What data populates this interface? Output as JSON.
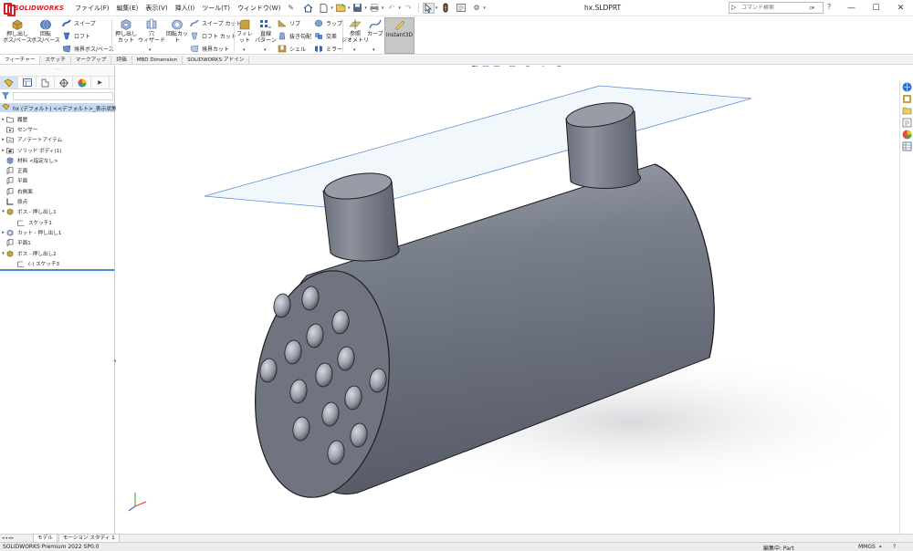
{
  "app": {
    "logo_text": "SOLIDWORKS",
    "menu": [
      "ファイル(F)",
      "編集(E)",
      "表示(V)",
      "挿入(I)",
      "ツール(T)",
      "ウィンドウ(W)"
    ],
    "document_title": "hx.SLDPRT",
    "search_placeholder": "コマンド検索",
    "help_label": "?",
    "window_buttons": [
      "—",
      "☐",
      "✕"
    ]
  },
  "ribbon": {
    "extrude_boss": "押し出し\nボス/ベース",
    "revolve_boss": "回転\nボス/ベース",
    "sweep": "スイープ",
    "loft": "ロフト",
    "boundary_boss": "境界ボス/ベース",
    "extrude_cut": "押し出し\nカット",
    "hole_wizard": "穴\nウィザード",
    "revolve_cut": "回転カット",
    "swept_cut": "スイープ カット",
    "lofted_cut": "ロフト カット",
    "boundary_cut": "境界カット",
    "fillet": "フィレット",
    "linear_pattern": "直線\nパターン",
    "rib": "リブ",
    "draft": "抜き勾配",
    "shell": "シェル",
    "wrap": "ラップ",
    "intersect": "交差",
    "mirror": "ミラー",
    "ref_geometry": "参照\nジオメトリ",
    "curves": "カーブ",
    "instant3d": "Instant3D"
  },
  "cm_tabs": [
    "フィーチャー",
    "スケッチ",
    "マークアップ",
    "評価",
    "MBD Dimension",
    "SOLIDWORKS アドイン"
  ],
  "tree": {
    "root": "hx (デフォルト) <<デフォルト>_表示状態 1>",
    "items": [
      {
        "label": "履歴",
        "expand": "▸"
      },
      {
        "label": "センサー",
        "expand": ""
      },
      {
        "label": "アノテートアイテム",
        "expand": "▸"
      },
      {
        "label": "ソリッド ボディ(1)",
        "expand": "▸"
      },
      {
        "label": "材料 <指定なし>",
        "expand": ""
      },
      {
        "label": "正面",
        "expand": ""
      },
      {
        "label": "平面",
        "expand": ""
      },
      {
        "label": "右側面",
        "expand": ""
      },
      {
        "label": "原点",
        "expand": ""
      },
      {
        "label": "ボス - 押し出し1",
        "expand": "▾"
      },
      {
        "label": "スケッチ1",
        "expand": ""
      },
      {
        "label": "カット - 押し出し1",
        "expand": "▸"
      },
      {
        "label": "平面1",
        "expand": ""
      },
      {
        "label": "ボス - 押し出し2",
        "expand": "▾"
      },
      {
        "label": "(-) スケッチ3",
        "expand": ""
      }
    ]
  },
  "bottom_tabs": [
    "モデル",
    "モーション スタディ 1"
  ],
  "status": {
    "version": "SOLIDWORKS Premium 2022 SP0.0",
    "editing": "編集中: Part",
    "units": "MMGS"
  },
  "colors": {
    "logo": "#d51f26",
    "body": "#7d8494",
    "selection_blue": "#c6daf1",
    "plane_edge": "#5b8fd8"
  }
}
